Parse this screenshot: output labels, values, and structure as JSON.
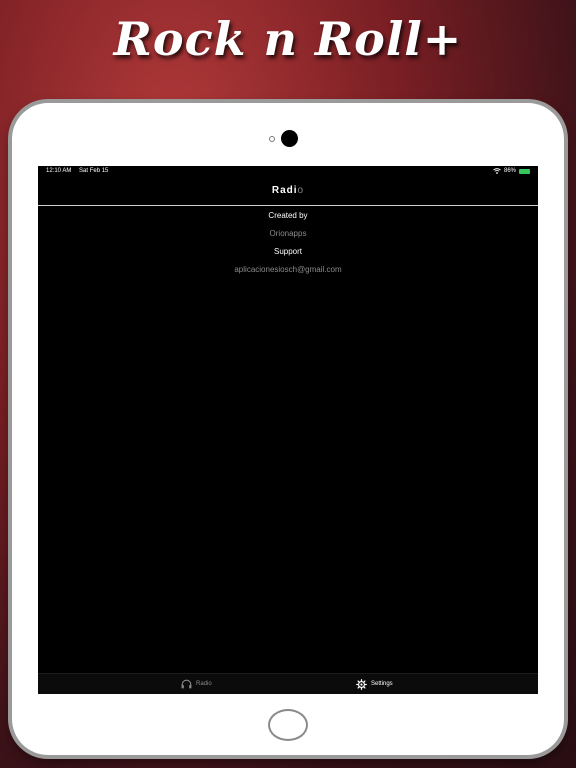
{
  "promo": {
    "title": "Rock n Roll+"
  },
  "status_bar": {
    "time": "12:10 AM",
    "date": "Sat Feb 15",
    "battery": "86%"
  },
  "nav": {
    "title_main": "Radi",
    "title_tail": "o"
  },
  "info": {
    "created_by_label": "Created by",
    "created_by_value": "Orionapps",
    "support_label": "Support",
    "support_value": "aplicacionesiosch@gmail.com"
  },
  "tabs": [
    {
      "label": "Radio",
      "icon": "headphones-icon",
      "selected": false
    },
    {
      "label": "Settings",
      "icon": "gear-icon",
      "selected": true
    }
  ],
  "colors": {
    "battery": "#35c759",
    "tab_selected": "#ffffff",
    "tab_unselected": "#8a8a8a"
  }
}
